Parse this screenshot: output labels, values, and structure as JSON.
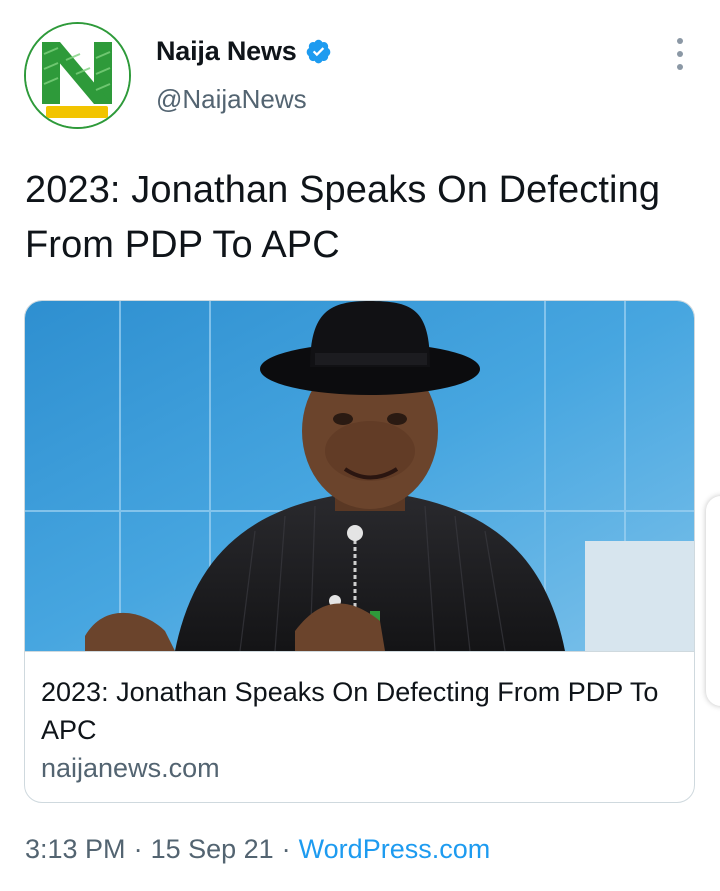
{
  "author": {
    "name": "Naija News",
    "handle": "@NaijaNews",
    "avatar_badge": "NaijaNews",
    "verified": true
  },
  "tweet": {
    "text": "2023: Jonathan Speaks On Defecting From PDP To APC"
  },
  "card": {
    "title": "2023: Jonathan Speaks On Defecting From PDP To APC",
    "domain": "naijanews.com"
  },
  "meta": {
    "time": "3:13 PM",
    "separator": "·",
    "date": "15 Sep 21",
    "source": "WordPress.com"
  },
  "colors": {
    "accent": "#1d9bf0",
    "secondary_text": "#536471",
    "brand_green": "#2e9a3a"
  },
  "icons": {
    "verified": "verified-badge-icon",
    "more": "more-vertical-icon"
  }
}
